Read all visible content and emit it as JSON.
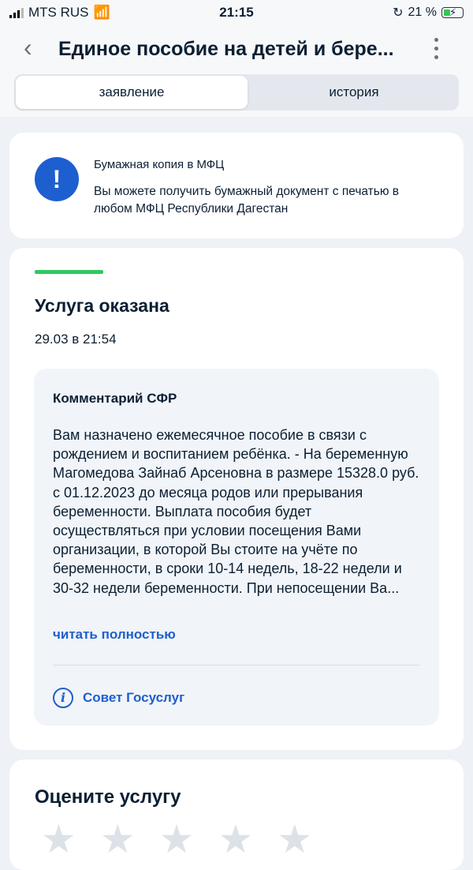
{
  "status_bar": {
    "carrier": "MTS RUS",
    "time": "21:15",
    "battery": "21 %"
  },
  "header": {
    "title": "Единое пособие на детей и бере..."
  },
  "tabs": [
    {
      "label": "заявление"
    },
    {
      "label": "история"
    }
  ],
  "notice": {
    "title": "Бумажная копия в МФЦ",
    "text": "Вы можете получить бумажный документ с печатью в любом МФЦ Республики Дагестан"
  },
  "service": {
    "status": "Услуга оказана",
    "date": "29.03 в 21:54",
    "comment": {
      "title": "Комментарий СФР",
      "text": "Вам назначено ежемесячное пособие в связи с рождением и воспитанием ребёнка. - На беременную Магомедова Зайнаб Арсеновна в размере 15328.0 руб. с 01.12.2023 до месяца родов или прерывания беременности. Выплата пособия будет осуществляться при условии посещения Вами организации, в которой Вы стоите на учёте по беременности, в сроки 10-14 недель, 18-22 недели и 30-32 недели беременности. При непосещении Ва...",
      "read_more": "читать полностью",
      "advice": "Совет Госуслуг"
    }
  },
  "rating": {
    "title": "Оцените услугу",
    "stars": 5
  },
  "colors": {
    "accent": "#1d5fcf",
    "success": "#2ec95c",
    "background": "#eef1f6"
  }
}
